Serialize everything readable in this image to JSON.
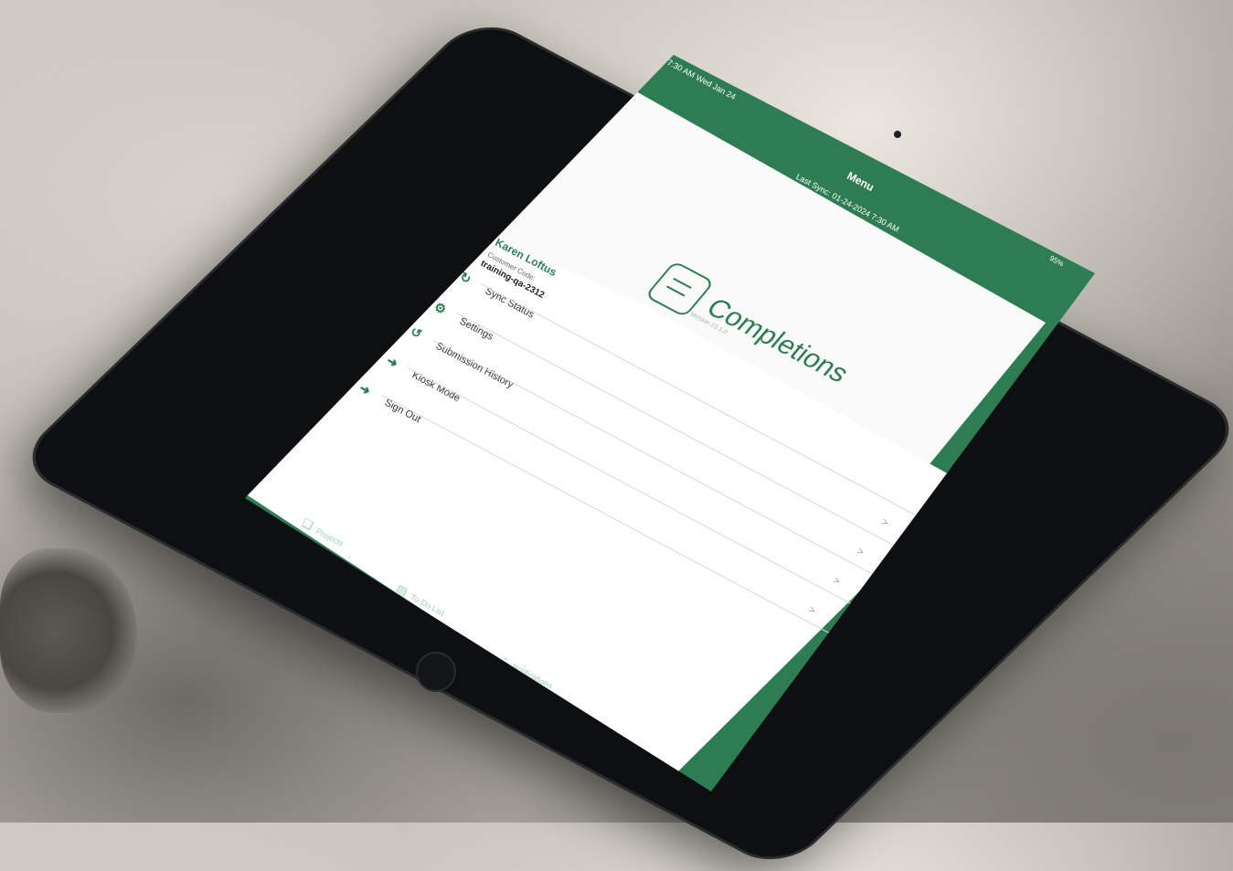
{
  "status_bar": {
    "time": "7:30 AM   Wed Jan 24",
    "battery": "95%"
  },
  "nav": {
    "title": "Menu",
    "last_sync": "Last Sync: 01-24-2024 7:30 AM"
  },
  "logo": {
    "name": "Completions",
    "version": "Version 23.1.0"
  },
  "user": {
    "name": "Karen Loftus",
    "customer_code_label": "Customer Code:",
    "customer_code": "training-qa-2312"
  },
  "menu": {
    "items": [
      {
        "label": "Sync Status",
        "icon": "sync-icon"
      },
      {
        "label": "Settings",
        "icon": "gear-icon"
      },
      {
        "label": "Submission History",
        "icon": "history-icon"
      },
      {
        "label": "Kiosk Mode",
        "icon": "exit-icon"
      },
      {
        "label": "Sign Out",
        "icon": "sign-out-icon"
      }
    ]
  },
  "tab_bar": {
    "items": [
      {
        "label": "Projects",
        "icon": "layers-icon"
      },
      {
        "label": "To-Do List",
        "icon": "clipboard-icon"
      },
      {
        "label": "Notifications",
        "icon": "bell-icon"
      },
      {
        "label": "Menu",
        "icon": "hamburger-icon",
        "active": true
      }
    ]
  },
  "colors": {
    "brand": "#2e7d52",
    "tab_inactive": "#9fd0b4"
  }
}
